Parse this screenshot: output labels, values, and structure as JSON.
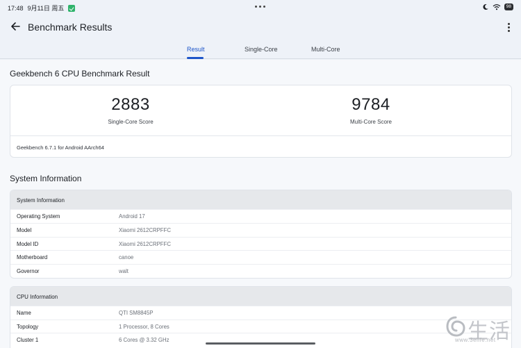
{
  "status_bar": {
    "time": "17:48",
    "date": "9月11日 周五",
    "battery": "98",
    "icons": [
      "shield-check-icon",
      "moon-icon",
      "wifi-icon",
      "battery-icon"
    ]
  },
  "app_bar": {
    "title": "Benchmark Results",
    "back_icon": "arrow-left-icon",
    "menu_icon": "more-vertical-icon"
  },
  "tabs": [
    {
      "label": "Result",
      "active": true
    },
    {
      "label": "Single-Core",
      "active": false
    },
    {
      "label": "Multi-Core",
      "active": false
    }
  ],
  "result": {
    "heading": "Geekbench 6 CPU Benchmark Result",
    "single_core_score": "2883",
    "single_core_label": "Single-Core Score",
    "multi_core_score": "9784",
    "multi_core_label": "Multi-Core Score",
    "version": "Geekbench 6.7.1 for Android AArch64"
  },
  "system_info": {
    "heading": "System Information",
    "card_header": "System Information",
    "rows": [
      {
        "label": "Operating System",
        "value": "Android 17"
      },
      {
        "label": "Model",
        "value": "Xiaomi 2612CRPFFC"
      },
      {
        "label": "Model ID",
        "value": "Xiaomi 2612CRPFFC"
      },
      {
        "label": "Motherboard",
        "value": "canoe"
      },
      {
        "label": "Governor",
        "value": "walt"
      }
    ]
  },
  "cpu_info": {
    "card_header": "CPU Information",
    "rows": [
      {
        "label": "Name",
        "value": "QTI SM8845P"
      },
      {
        "label": "Topology",
        "value": "1 Processor, 8 Cores"
      },
      {
        "label": "Cluster 1",
        "value": "6 Cores @ 3.32 GHz"
      }
    ]
  },
  "watermark": {
    "logo_text": "生活",
    "url": "www.3elife.net"
  },
  "colors": {
    "accent": "#1d55c9",
    "background": "#eef2f8",
    "card_header": "#e6e8eb"
  }
}
